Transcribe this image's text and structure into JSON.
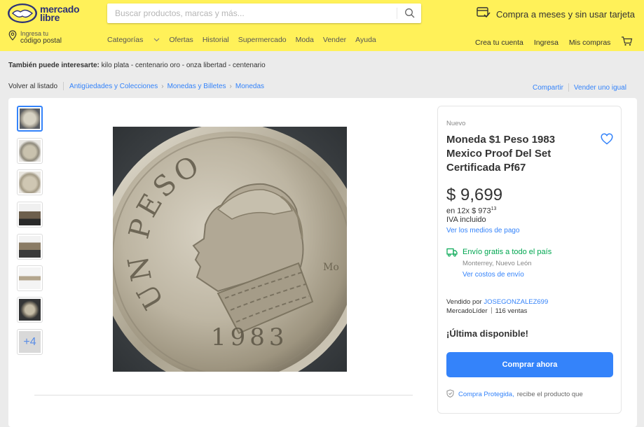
{
  "header": {
    "logo_line1": "mercado",
    "logo_line2": "libre",
    "search_placeholder": "Buscar productos, marcas y más...",
    "promo": "Compra a meses y sin usar tarjeta",
    "postal_line1": "Ingresa tu",
    "postal_line2": "código postal",
    "nav": [
      "Categorías",
      "Ofertas",
      "Historial",
      "Supermercado",
      "Moda",
      "Vender",
      "Ayuda"
    ],
    "user_nav": [
      "Crea tu cuenta",
      "Ingresa",
      "Mis compras"
    ],
    "brand_yellow": "#fff159",
    "brand_blue": "#2d3277"
  },
  "related": {
    "label": "También puede interesarte:",
    "items": "kilo plata - centenario oro - onza libertad - centenario"
  },
  "breadcrumb": {
    "back": "Volver al listado",
    "items": [
      "Antigüedades y Colecciones",
      "Monedas y Billetes",
      "Monedas"
    ],
    "share": "Compartir",
    "sell": "Vender uno igual"
  },
  "gallery": {
    "more_label": "+4",
    "thumb_count": 7
  },
  "product": {
    "condition": "Nuevo",
    "title": "Moneda $1 Peso 1983 Mexico Proof Del Set Certificada Pf67",
    "price": "$ 9,699",
    "installments": "en 12x $ 973",
    "installments_cents": "13",
    "iva": "IVA incluido",
    "payment_link": "Ver los medios de pago",
    "shipping": "Envío gratis a todo el país",
    "location": "Monterrey, Nuevo León",
    "shipping_cost_link": "Ver costos de envío",
    "seller_prefix": "Vendido por",
    "seller_name": "JOSEGONZALEZ699",
    "seller_badge": "MercadoLíder",
    "sales": "116 ventas",
    "stock": "¡Última disponible!",
    "buy_button": "Comprar ahora",
    "protected_label": "Compra Protegida,",
    "protected_text": "recibe el producto que",
    "accent_blue": "#3483fa",
    "accent_green": "#00a650"
  },
  "coin": {
    "legend": "UN PESO",
    "year": "1983"
  }
}
